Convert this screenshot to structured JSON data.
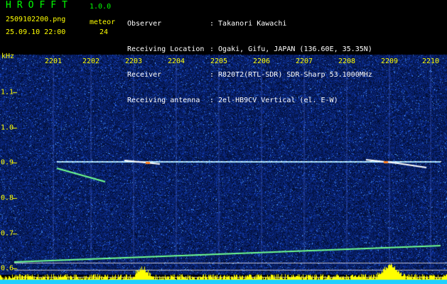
{
  "header": {
    "app_title": "HROFFT",
    "app_version": "1.0.0",
    "filename": "2509102200.png",
    "datetime": "25.09.10 22:00",
    "meteor_label": "meteor",
    "meteor_count": "24",
    "info": [
      {
        "label": "Observer",
        "value": ": Takanori Kawachi"
      },
      {
        "label": "Receiving Location",
        "value": ": Ogaki, Gifu, JAPAN (136.60E, 35.35N)"
      },
      {
        "label": "Receiver",
        "value": ": R820T2(RTL-SDR) SDR-Sharp 53.1000MHz"
      },
      {
        "label": "Receiving antenna",
        "value": ": 2el-HB9CV Vertical (el. E-W)"
      }
    ]
  },
  "axis": {
    "unit": "kHz",
    "time_labels": [
      "2201",
      "2202",
      "2203",
      "2204",
      "2205",
      "2206",
      "2207",
      "2208",
      "2209",
      "2210"
    ],
    "freq_labels": [
      "1.1",
      "1.0",
      "0.9",
      "0.8",
      "0.7",
      "0.6"
    ]
  },
  "colors": {
    "background": "#000000",
    "label_yellow": "#ffff00",
    "title_green": "#00ff00",
    "noise_blue": "#1a2a9a",
    "carrier": "#a0e0ff",
    "drift_line": "#70ff90",
    "histogram": "#ffff00",
    "histogram_base": "#20d0ff"
  }
}
